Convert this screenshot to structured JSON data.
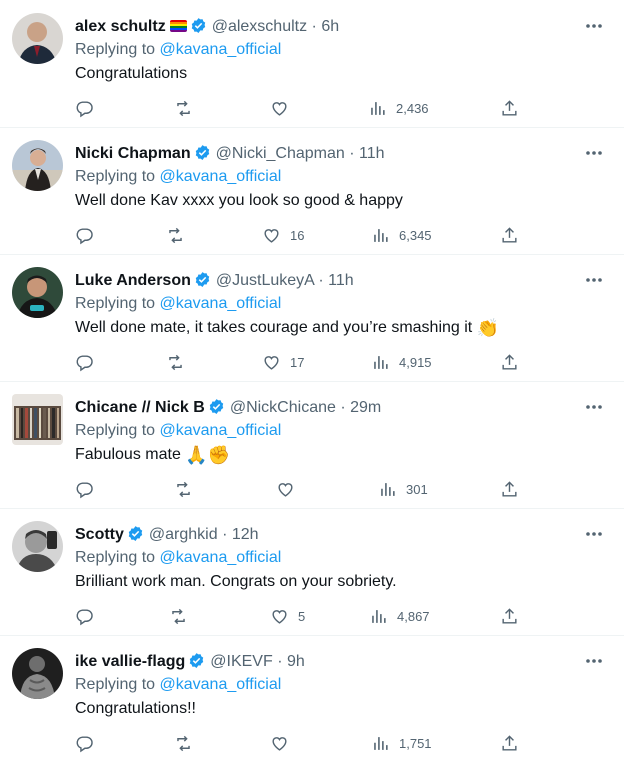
{
  "colors": {
    "link": "#1d9bf0",
    "muted": "#536471",
    "text": "#0f1419",
    "verified": "#1d9bf0"
  },
  "tweets": [
    {
      "name": "alex schultz",
      "handle": "@alexschultz",
      "time": "· 6h",
      "replying_prefix": "Replying to",
      "replying_to": "@kavana_official",
      "text": "Congratulations",
      "emoji": "",
      "replies": "",
      "retweets": "",
      "likes": "",
      "views": "2,436"
    },
    {
      "name": "Nicki Chapman",
      "handle": "@Nicki_Chapman",
      "time": "· 11h",
      "replying_prefix": "Replying to",
      "replying_to": "@kavana_official",
      "text": "Well done Kav xxxx you look so good & happy",
      "emoji": "",
      "replies": "",
      "retweets": "",
      "likes": "16",
      "views": "6,345"
    },
    {
      "name": "Luke Anderson",
      "handle": "@JustLukeyA",
      "time": "· 11h",
      "replying_prefix": "Replying to",
      "replying_to": "@kavana_official",
      "text": "Well done mate, it takes courage and you’re smashing it",
      "emoji": "👏",
      "replies": "",
      "retweets": "",
      "likes": "17",
      "views": "4,915"
    },
    {
      "name": "Chicane // Nick B",
      "handle": "@NickChicane",
      "time": "· 29m",
      "replying_prefix": "Replying to",
      "replying_to": "@kavana_official",
      "text": "Fabulous mate",
      "emoji": "🙏✊",
      "replies": "",
      "retweets": "",
      "likes": "",
      "views": "301"
    },
    {
      "name": "Scotty",
      "handle": "@arghkid",
      "time": "· 12h",
      "replying_prefix": "Replying to",
      "replying_to": "@kavana_official",
      "text": "Brilliant work man. Congrats on your sobriety.",
      "emoji": "",
      "replies": "",
      "retweets": "",
      "likes": "5",
      "views": "4,867"
    },
    {
      "name": "ike vallie-flagg",
      "handle": "@IKEVF",
      "time": "· 9h",
      "replying_prefix": "Replying to",
      "replying_to": "@kavana_official",
      "text": "Congratulations!!",
      "emoji": "",
      "replies": "",
      "retweets": "",
      "likes": "",
      "views": "1,751"
    }
  ]
}
